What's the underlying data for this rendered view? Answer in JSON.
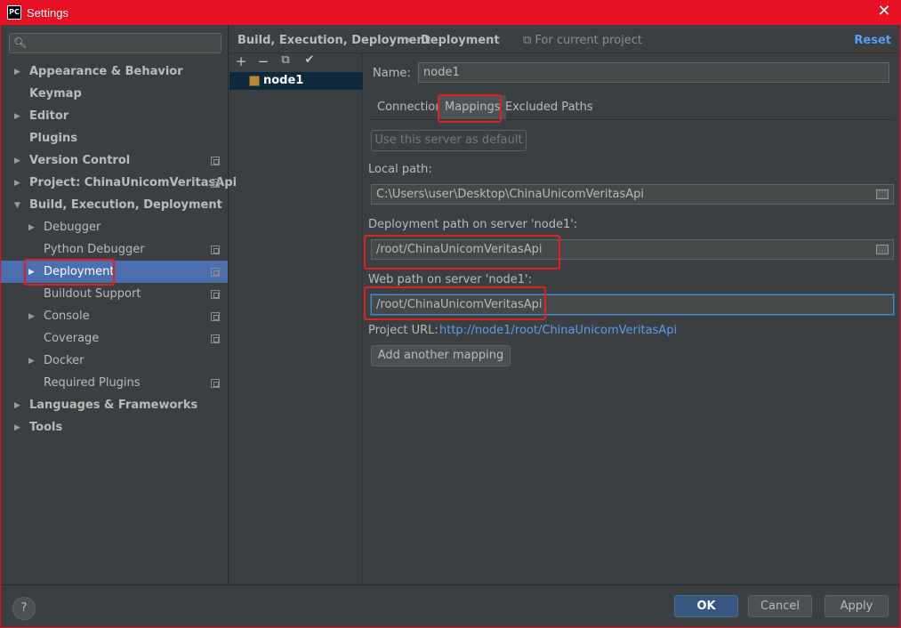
{
  "window": {
    "title": "Settings",
    "app_icon_text": "PC",
    "close_glyph": "✕"
  },
  "sidebar": {
    "search_placeholder": "",
    "items": [
      {
        "label": "Appearance & Behavior",
        "level": 0,
        "arrow": "▶",
        "bold": true
      },
      {
        "label": "Keymap",
        "level": 0,
        "arrow": "",
        "bold": true
      },
      {
        "label": "Editor",
        "level": 0,
        "arrow": "▶",
        "bold": true
      },
      {
        "label": "Plugins",
        "level": 0,
        "arrow": "",
        "bold": true
      },
      {
        "label": "Version Control",
        "level": 0,
        "arrow": "▶",
        "bold": true,
        "project_icon": true
      },
      {
        "label": "Project: ChinaUnicomVeritasApi",
        "level": 0,
        "arrow": "▶",
        "bold": true,
        "project_icon": true
      },
      {
        "label": "Build, Execution, Deployment",
        "level": 0,
        "arrow": "▼",
        "bold": true
      },
      {
        "label": "Debugger",
        "level": 1,
        "arrow": "▶"
      },
      {
        "label": "Python Debugger",
        "level": 1,
        "arrow": "",
        "project_icon": true
      },
      {
        "label": "Deployment",
        "level": 1,
        "arrow": "▶",
        "selected": true,
        "project_icon": true
      },
      {
        "label": "Buildout Support",
        "level": 1,
        "arrow": "",
        "project_icon": true
      },
      {
        "label": "Console",
        "level": 1,
        "arrow": "▶",
        "project_icon": true
      },
      {
        "label": "Coverage",
        "level": 1,
        "arrow": "",
        "project_icon": true
      },
      {
        "label": "Docker",
        "level": 1,
        "arrow": "▶"
      },
      {
        "label": "Required Plugins",
        "level": 1,
        "arrow": "",
        "project_icon": true
      },
      {
        "label": "Languages & Frameworks",
        "level": 0,
        "arrow": "▶",
        "bold": true
      },
      {
        "label": "Tools",
        "level": 0,
        "arrow": "▶",
        "bold": true
      }
    ]
  },
  "header": {
    "breadcrumb_parent": "Build, Execution, Deployment",
    "breadcrumb_sep": "›",
    "breadcrumb_current": "Deployment",
    "for_project": "For current project",
    "reset_label": "Reset"
  },
  "server_toolbar": {
    "add": "+",
    "remove": "−",
    "copy": "⧉",
    "default": "✔"
  },
  "servers": [
    {
      "name": "node1",
      "selected": true
    }
  ],
  "form": {
    "name_label": "Name:",
    "name_value": "node1",
    "tabs": [
      "Connection",
      "Mappings",
      "Excluded Paths"
    ],
    "active_tab": "Mappings",
    "use_default_label": "Use this server as default",
    "local_path_label": "Local path:",
    "local_path_value": "C:\\Users\\user\\Desktop\\ChinaUnicomVeritasApi",
    "deploy_path_label": "Deployment path on server 'node1':",
    "deploy_path_value": "/root/ChinaUnicomVeritasApi",
    "web_path_label": "Web path on server 'node1':",
    "web_path_value": "/root/ChinaUnicomVeritasApi",
    "project_url_label": "Project URL:",
    "project_url_value": "http://node1/root/ChinaUnicomVeritasApi",
    "add_mapping_label": "Add another mapping"
  },
  "footer": {
    "help": "?",
    "ok": "OK",
    "cancel": "Cancel",
    "apply": "Apply"
  },
  "colors": {
    "title_bar": "#e81123",
    "background": "#3c3f41",
    "selection": "#4b6eaf",
    "link": "#589df6",
    "highlight_box": "#e0221f"
  }
}
